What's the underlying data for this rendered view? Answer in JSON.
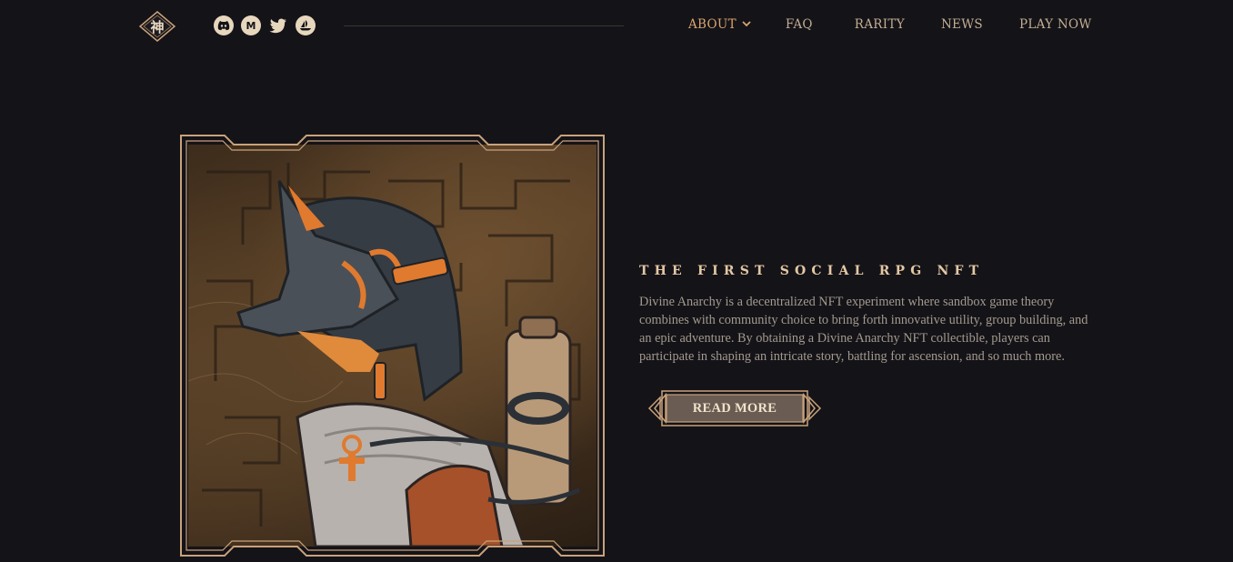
{
  "header": {
    "logo_glyph": "神",
    "socials": [
      {
        "icon": "discord-icon",
        "glyph": "◕"
      },
      {
        "icon": "medium-icon",
        "glyph": "M"
      },
      {
        "icon": "twitter-icon",
        "glyph": "🐦"
      },
      {
        "icon": "opensea-icon",
        "glyph": "⛵"
      }
    ],
    "nav": {
      "about": "ABOUT",
      "faq": "FAQ",
      "rarity": "RARITY",
      "news": "NEWS",
      "play": "PLAY NOW"
    }
  },
  "hero": {
    "headline": "THE FIRST SOCIAL RPG NFT",
    "description": "Divine Anarchy is a decentralized NFT experiment where sandbox game theory combines with community choice to bring forth innovative utility, group building, and an epic adventure. By obtaining a Divine Anarchy NFT collectible, players can participate in shaping an intricate story, battling for ascension, and so much more.",
    "cta_label": "READ MORE"
  },
  "colors": {
    "background": "#141318",
    "accent": "#d9a56e",
    "frame": "#c9a27b",
    "button_fill": "#6a5c52"
  }
}
